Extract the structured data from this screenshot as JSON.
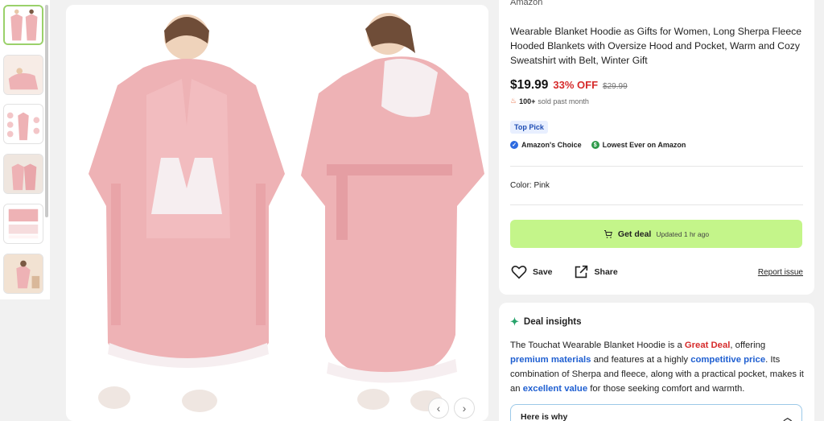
{
  "product": {
    "brand": "Amazon",
    "title": "Wearable Blanket Hoodie as Gifts for Women, Long Sherpa Fleece Hooded Blankets with Oversize Hood and Pocket, Warm and Cozy Sweatshirt with Belt, Winter Gift",
    "price": "$19.99",
    "discount": "33% OFF",
    "old_price": "$29.99",
    "sold_count": "100+",
    "sold_suffix": "sold past month",
    "top_pick": "Top Pick",
    "badges": [
      "Amazon's Choice",
      "Lowest Ever on Amazon"
    ],
    "color_label": "Color: Pink"
  },
  "deal": {
    "button_label": "Get deal",
    "updated": "Updated 1 hr ago"
  },
  "actions": {
    "save": "Save",
    "share": "Share",
    "report": "Report issue"
  },
  "insights": {
    "heading": "Deal insights",
    "body": {
      "t1": "The Touchat Wearable Blanket Hoodie is a ",
      "h1": "Great Deal",
      "t2": ", offering ",
      "h2": "premium materials",
      "t3": " and features at a highly ",
      "h3": "competitive price",
      "t4": ". Its combination of Sherpa and fleece, along with a practical pocket, makes it an ",
      "h4": "excellent value",
      "t5": " for those seeking comfort and warmth."
    },
    "why": "Here is why"
  },
  "gallery": {
    "thumbnail_count": 6,
    "selected_index": 0
  },
  "colors": {
    "deal_green": "#c4f58a",
    "discount_red": "#d62b2b",
    "link_blue": "#1f5fd1",
    "robe_pink": "#eeb2b5"
  },
  "icons": [
    "cart-icon",
    "heart-icon",
    "share-icon",
    "sparkle-icon",
    "chevron-up-icon",
    "chevron-left-icon",
    "chevron-right-icon",
    "check-badge-icon",
    "dollar-badge-icon",
    "flame-icon"
  ]
}
